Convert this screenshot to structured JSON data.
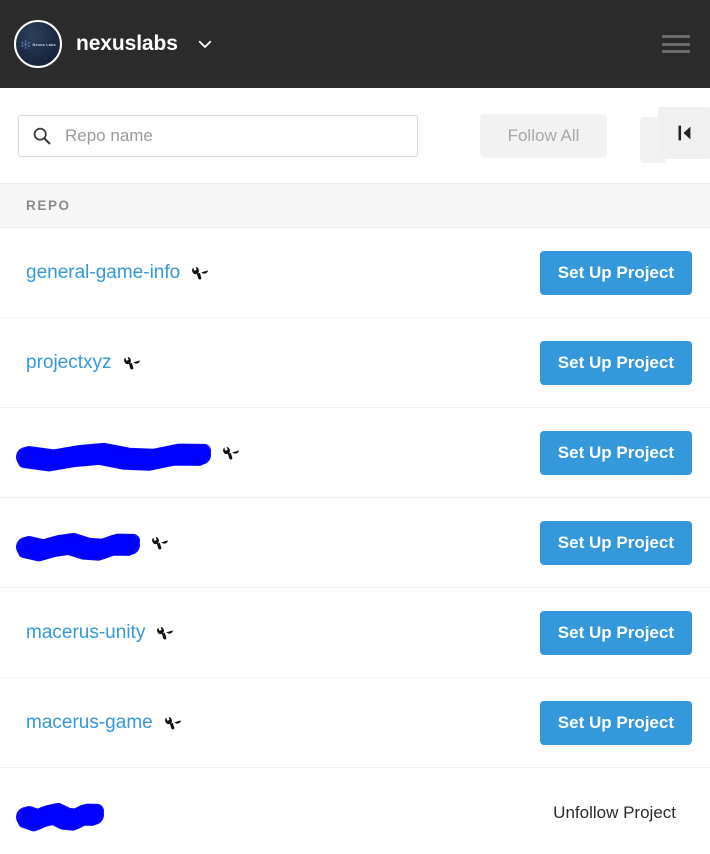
{
  "header": {
    "org_name": "nexuslabs",
    "avatar_wordmark": "Nexus Labs",
    "avatar_icon": "nexus-logo-icon",
    "dropdown_icon": "chevron-down-icon",
    "menu_icon": "hamburger-menu-icon",
    "background_color": "#2b2b2b"
  },
  "toolbar": {
    "search_placeholder": "Repo name",
    "search_value": "",
    "search_icon": "search-icon",
    "follow_all_label": "Follow All",
    "follow_all_disabled": true,
    "collapse_icon": "skip-to-start-icon"
  },
  "list": {
    "column_header": "REPO",
    "setup_label": "Set Up Project",
    "unfollow_label": "Unfollow Project",
    "link_color": "#3498db",
    "redaction_color": "#0000ff",
    "rows": [
      {
        "name": "general-game-info",
        "redacted": false,
        "wrench": true,
        "action": "setup"
      },
      {
        "name": "projectxyz",
        "redacted": false,
        "wrench": true,
        "action": "setup"
      },
      {
        "name": "",
        "redacted": true,
        "wrench": true,
        "action": "setup",
        "redaction_width": 175
      },
      {
        "name": "",
        "redacted": true,
        "wrench": true,
        "action": "setup",
        "redaction_width": 104
      },
      {
        "name": "macerus-unity",
        "redacted": false,
        "wrench": true,
        "action": "setup"
      },
      {
        "name": "macerus-game",
        "redacted": false,
        "wrench": true,
        "action": "setup"
      },
      {
        "name": "",
        "redacted": true,
        "wrench": false,
        "action": "unfollow",
        "redaction_width": 68
      }
    ]
  }
}
